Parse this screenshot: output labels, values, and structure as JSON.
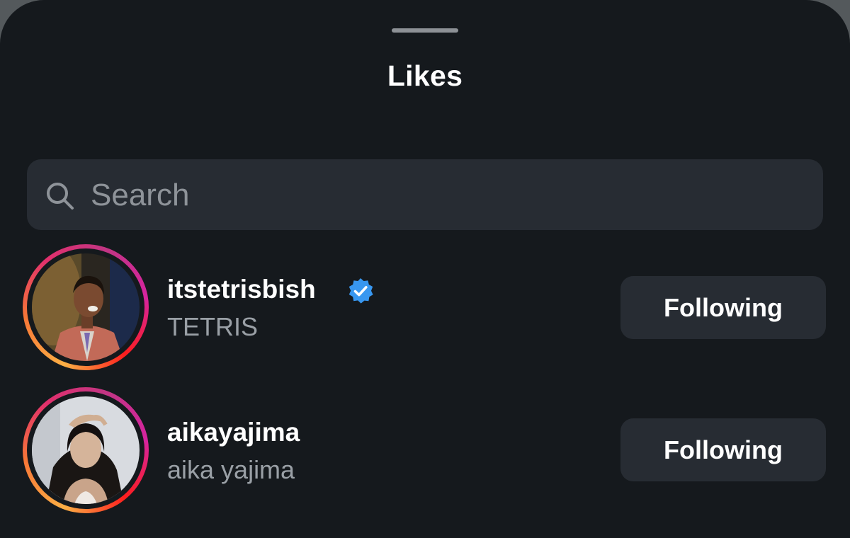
{
  "sheet": {
    "title": "Likes"
  },
  "search": {
    "placeholder": "Search",
    "value": ""
  },
  "likers": [
    {
      "username": "itstetrisbish",
      "full_name": "TETRIS",
      "verified": true,
      "button_label": "Following"
    },
    {
      "username": "aikayajima",
      "full_name": "aika yajima",
      "verified": false,
      "button_label": "Following"
    }
  ],
  "colors": {
    "background": "#15191d",
    "surface": "#272c33",
    "text_primary": "#ffffff",
    "text_secondary": "#9aa0a6",
    "verified_badge": "#3897f0"
  }
}
